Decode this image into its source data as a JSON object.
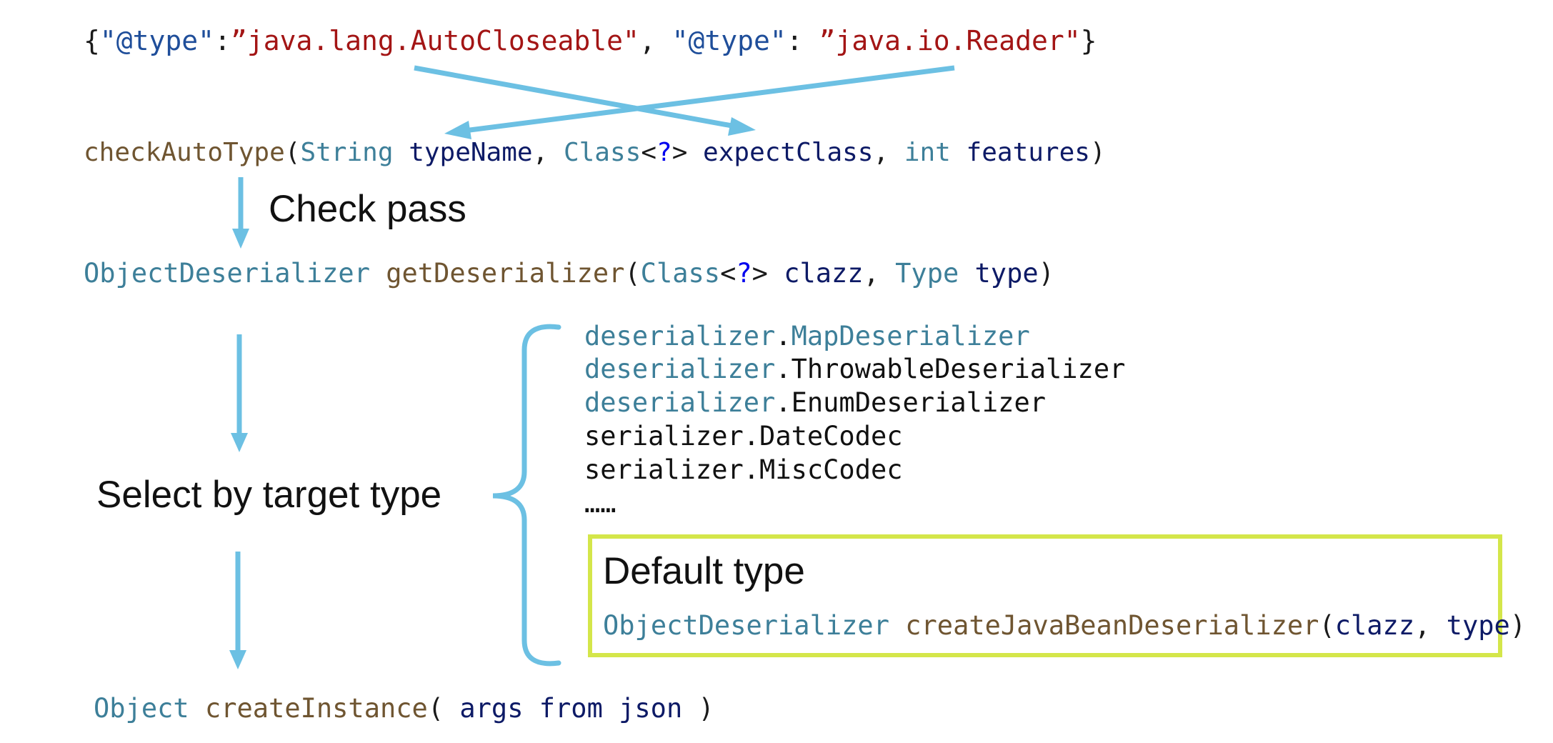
{
  "json_line": {
    "open": "{",
    "key1": "\"@type\"",
    "colon1": ":",
    "val1": "”java.lang.AutoCloseable\"",
    "sep": ", ",
    "key2": "\"@type\"",
    "colon2": ": ",
    "val2": "”java.io.Reader\"",
    "close": "}"
  },
  "check_line": {
    "fn": "checkAutoType",
    "open": "(",
    "t1": "String",
    "p1": "typeName",
    "c1": ", ",
    "t2": "Class",
    "lt": "<",
    "q": "?",
    "gt": "> ",
    "p2": "expectClass",
    "c2": ", ",
    "t3": "int",
    "p3": "features",
    "close": ")"
  },
  "labels": {
    "check_pass": "Check pass",
    "select_by_target": "Select by target type",
    "default_type": "Default type"
  },
  "getdes_line": {
    "ret": "ObjectDeserializer",
    "fn": "getDeserializer",
    "open": "(",
    "t1": "Class",
    "lt": "<",
    "q": "?",
    "gt": "> ",
    "p1": "clazz",
    "c1": ", ",
    "t2": "Type",
    "p2": "type",
    "close": ")"
  },
  "deserializers": [
    {
      "pkg": "deserializer",
      "dot": ".",
      "name": "MapDeserializer"
    },
    {
      "pkg": "deserializer",
      "dot": ".",
      "name": "ThrowableDeserializer"
    },
    {
      "pkg": "deserializer",
      "dot": ".",
      "name": "EnumDeserializer"
    },
    {
      "pkg": "serializer",
      "dot": ".",
      "name": "DateCodec"
    },
    {
      "pkg": "serializer",
      "dot": ".",
      "name": "MiscCodec"
    },
    {
      "pkg": "",
      "dot": "",
      "name": "……"
    }
  ],
  "default_call": {
    "ret": "ObjectDeserializer",
    "fn": "createJavaBeanDeserializer",
    "open": "(",
    "p1": "clazz",
    "c1": ", ",
    "p2": "type",
    "close": ")"
  },
  "create_line": {
    "ret": "Object",
    "fn": "createInstance",
    "open": "( ",
    "args": "args from json",
    "close": " )"
  },
  "colors": {
    "arrow": "#6cc0e3",
    "default_box_border": "#d4e64a",
    "string_literal": "#a31515",
    "json_key": "#1f4e9a",
    "function": "#6f5531",
    "type": "#3d7f99",
    "param": "#0d1a66"
  }
}
